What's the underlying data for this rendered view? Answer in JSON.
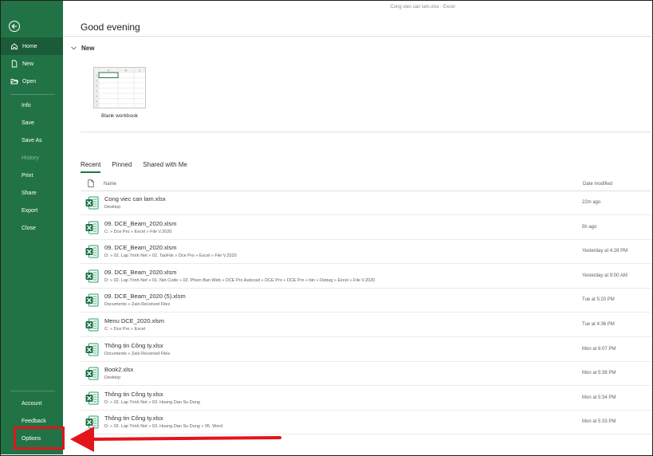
{
  "window": {
    "title": "Cong viec can lam.xlsx  -  Excel"
  },
  "sidebar": {
    "items": [
      {
        "label": "Home",
        "icon": "home-icon",
        "active": true
      },
      {
        "label": "New",
        "icon": "new-doc-icon"
      },
      {
        "label": "Open",
        "icon": "folder-open-icon"
      },
      {
        "label": "Info"
      },
      {
        "label": "Save"
      },
      {
        "label": "Save As"
      },
      {
        "label": "History",
        "disabled": true
      },
      {
        "label": "Print"
      },
      {
        "label": "Share"
      },
      {
        "label": "Export"
      },
      {
        "label": "Close"
      }
    ],
    "bottom": [
      {
        "label": "Account"
      },
      {
        "label": "Feedback"
      },
      {
        "label": "Options"
      }
    ]
  },
  "main": {
    "greeting": "Good evening",
    "new_section": {
      "title": "New",
      "template_label": "Blank workbook"
    },
    "tabs": [
      {
        "label": "Recent",
        "selected": true
      },
      {
        "label": "Pinned"
      },
      {
        "label": "Shared with Me"
      }
    ],
    "columns": {
      "name": "Name",
      "modified": "Date modified"
    },
    "files": [
      {
        "name": "Cong viec can lam.xlsx",
        "path": "Desktop",
        "date": "22m ago"
      },
      {
        "name": "09. DCE_Beam_2020.xlsm",
        "path": "C: » Dce Pro » Excel » File V.2020",
        "date": "5h ago"
      },
      {
        "name": "09. DCE_Beam_2020.xlsm",
        "path": "D: » 02. Lap Trinh Net » 02. TaoFile » Dce Pro » Excel » File V.2020",
        "date": "Yesterday at 4:28 PM"
      },
      {
        "name": "09. DCE_Beam_2020.xlsm",
        "path": "D: » 02. Lap Trinh Net » 01. Net Code » 02. Phien Ban Web » DCE Pro Autocad » DCE Pro » DCE Pro » bin » Debug » Excel » File V.2020",
        "date": "Yesterday at 9:00 AM"
      },
      {
        "name": "09. DCE_Beam_2020 (5).xlsm",
        "path": "Documents » Zalo Received Files",
        "date": "Tue at 5:20 PM"
      },
      {
        "name": "Menu DCE_2020.xlsm",
        "path": "C: » Dce Pro » Excel",
        "date": "Tue at 4:36 PM"
      },
      {
        "name": "Thông tin Công ty.xlsx",
        "path": "Documents » Zalo Received Files",
        "date": "Mon at 6:07 PM"
      },
      {
        "name": "Book2.xlsx",
        "path": "Desktop",
        "date": "Mon at 5:38 PM"
      },
      {
        "name": "Thông tin Công ty.xlsx",
        "path": "D: » 02. Lap Trinh Net » 03. Huong Dan Su Dung",
        "date": "Mon at 5:34 PM"
      },
      {
        "name": "Thông tin Công ty.xlsx",
        "path": "D: » 02. Lap Trinh Net » 03. Huong Dan Su Dung » 05. Word",
        "date": "Mon at 5:33 PM"
      }
    ]
  },
  "colors": {
    "brand": "#217346",
    "annotation": "#e3141b"
  }
}
